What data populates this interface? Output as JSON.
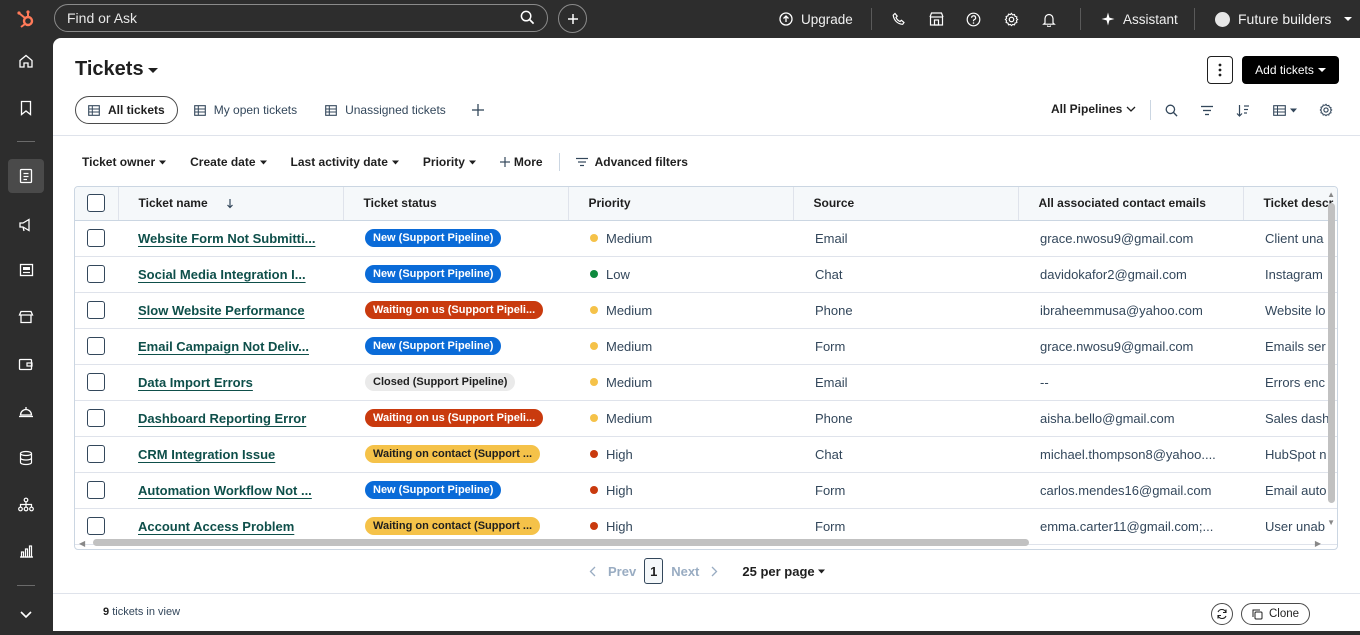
{
  "topbar": {
    "search_placeholder": "Find or Ask",
    "upgrade_label": "Upgrade",
    "assistant_label": "Assistant",
    "account_label": "Future builders"
  },
  "page": {
    "title": "Tickets",
    "add_button": "Add tickets"
  },
  "views": [
    {
      "label": "All tickets",
      "active": true
    },
    {
      "label": "My open tickets",
      "active": false
    },
    {
      "label": "Unassigned tickets",
      "active": false
    }
  ],
  "pipeline_select": "All Pipelines",
  "filters": [
    "Ticket owner",
    "Create date",
    "Last activity date",
    "Priority"
  ],
  "more_label": "More",
  "advanced_filters_label": "Advanced filters",
  "columns": [
    "Ticket name",
    "Ticket status",
    "Priority",
    "Source",
    "All associated contact emails",
    "Ticket descr"
  ],
  "status_colors": {
    "new": {
      "bg": "#0a6bd8",
      "fg": "#ffffff"
    },
    "waiting_us": {
      "bg": "#c93a0e",
      "fg": "#ffffff"
    },
    "closed": {
      "bg": "#eaeaea",
      "fg": "#1f1f1f"
    },
    "waiting_contact": {
      "bg": "#f5c249",
      "fg": "#1f1f1f"
    }
  },
  "priority_colors": {
    "Medium": "#f5c249",
    "Low": "#0e8a3e",
    "High": "#c93a0e"
  },
  "rows": [
    {
      "name": "Website Form Not Submitti...",
      "status": "New (Support Pipeline)",
      "status_type": "new",
      "priority": "Medium",
      "source": "Email",
      "email": "grace.nwosu9@gmail.com",
      "desc": "Client una"
    },
    {
      "name": "Social Media Integration I...",
      "status": "New (Support Pipeline)",
      "status_type": "new",
      "priority": "Low",
      "source": "Chat",
      "email": "davidokafor2@gmail.com",
      "desc": "Instagram"
    },
    {
      "name": "Slow Website Performance",
      "status": "Waiting on us (Support Pipeli...",
      "status_type": "waiting_us",
      "priority": "Medium",
      "source": "Phone",
      "email": "ibraheemmusa@yahoo.com",
      "desc": "Website lo"
    },
    {
      "name": "Email Campaign Not Deliv...",
      "status": "New (Support Pipeline)",
      "status_type": "new",
      "priority": "Medium",
      "source": "Form",
      "email": "grace.nwosu9@gmail.com",
      "desc": "Emails ser"
    },
    {
      "name": "Data Import Errors",
      "status": "Closed (Support Pipeline)",
      "status_type": "closed",
      "priority": "Medium",
      "source": "Email",
      "email": "--",
      "desc": "Errors enc"
    },
    {
      "name": "Dashboard Reporting Error",
      "status": "Waiting on us (Support Pipeli...",
      "status_type": "waiting_us",
      "priority": "Medium",
      "source": "Phone",
      "email": "aisha.bello@gmail.com",
      "desc": "Sales dash"
    },
    {
      "name": "CRM Integration Issue",
      "status": "Waiting on contact (Support ...",
      "status_type": "waiting_contact",
      "priority": "High",
      "source": "Chat",
      "email": "michael.thompson8@yahoo....",
      "desc": "HubSpot n"
    },
    {
      "name": "Automation Workflow Not ...",
      "status": "New (Support Pipeline)",
      "status_type": "new",
      "priority": "High",
      "source": "Form",
      "email": "carlos.mendes16@gmail.com",
      "desc": "Email auto"
    },
    {
      "name": "Account Access Problem",
      "status": "Waiting on contact (Support ...",
      "status_type": "waiting_contact",
      "priority": "High",
      "source": "Form",
      "email": "emma.carter11@gmail.com;...",
      "desc": "User unab"
    }
  ],
  "pagination": {
    "prev": "Prev",
    "page": "1",
    "next": "Next",
    "per_page": "25 per page"
  },
  "footer": {
    "count": "9",
    "count_suffix": "tickets in view",
    "clone": "Clone"
  }
}
